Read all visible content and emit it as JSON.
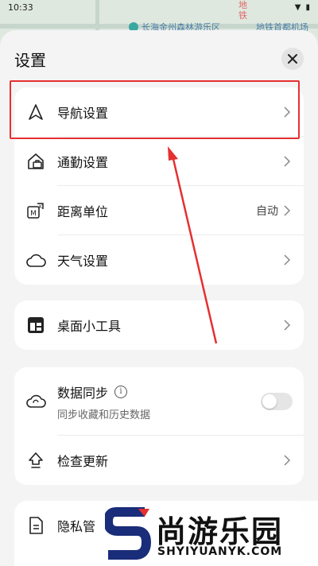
{
  "status_bar": {
    "time": "10:33"
  },
  "map": {
    "place_label": "长海金州森林游乐区",
    "place_label_right": "地铁首都机场",
    "vertical_label": "地铁"
  },
  "sheet": {
    "title": "设置",
    "close_icon": "close-icon"
  },
  "group1": {
    "items": [
      {
        "label": "导航设置",
        "icon": "navigation-arrow-icon",
        "value": ""
      },
      {
        "label": "通勤设置",
        "icon": "commute-icon",
        "value": ""
      },
      {
        "label": "距离单位",
        "icon": "distance-unit-icon",
        "value": "自动"
      },
      {
        "label": "天气设置",
        "icon": "cloud-icon",
        "value": ""
      }
    ]
  },
  "group2": {
    "items": [
      {
        "label": "桌面小工具",
        "icon": "widget-icon"
      }
    ]
  },
  "group3": {
    "sync": {
      "label": "数据同步",
      "sublabel": "同步收藏和历史数据",
      "enabled": false
    },
    "update": {
      "label": "检查更新",
      "icon": "update-icon"
    }
  },
  "group4": {
    "privacy": {
      "label": "隐私管",
      "icon": "document-icon"
    }
  },
  "watermark": {
    "cn": "尚游乐园",
    "en": "SHYIYUANYK.COM"
  },
  "colors": {
    "highlight": "#e53030",
    "accent_text": "#111111"
  }
}
